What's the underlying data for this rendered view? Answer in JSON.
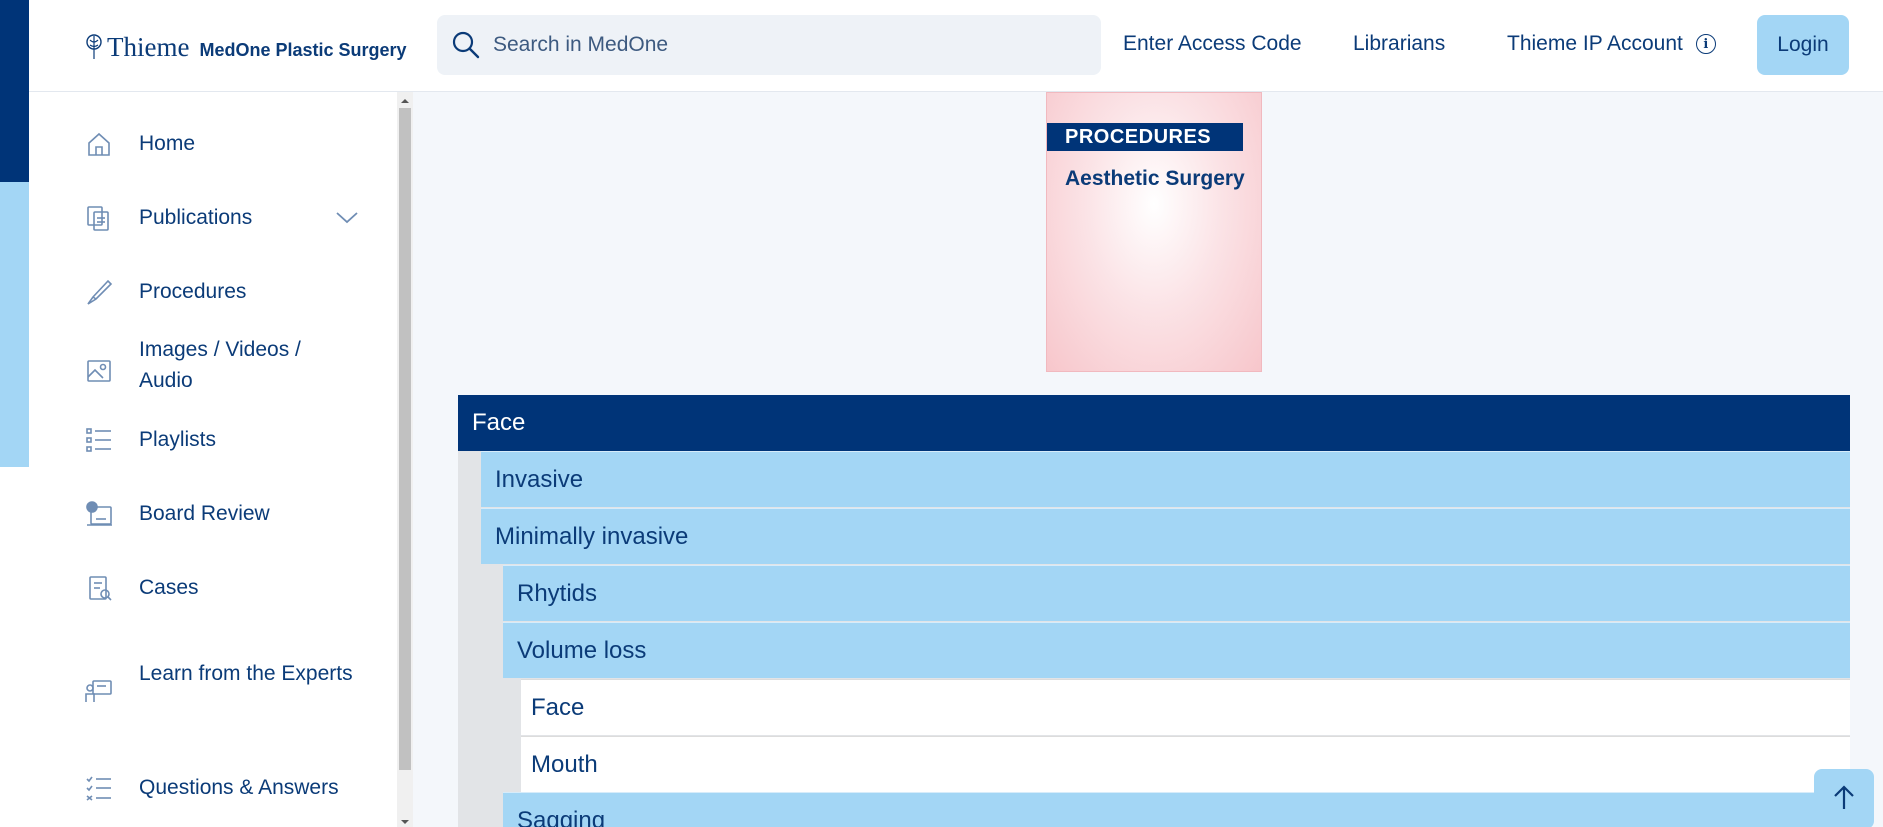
{
  "header": {
    "brand_name": "Thieme",
    "brand_product": "MedOne Plastic Surgery",
    "search_placeholder": "Search in MedOne",
    "links": {
      "access_code": "Enter Access Code",
      "librarians": "Librarians",
      "ip_account": "Thieme IP Account"
    },
    "login_label": "Login"
  },
  "sidebar": {
    "items": [
      {
        "label": "Home",
        "icon": "home-icon"
      },
      {
        "label": "Publications",
        "icon": "publications-icon",
        "expandable": true
      },
      {
        "label": "Procedures",
        "icon": "scalpel-icon"
      },
      {
        "label": "Images / Videos / Audio",
        "icon": "image-icon"
      },
      {
        "label": "Playlists",
        "icon": "playlist-icon"
      },
      {
        "label": "Board Review",
        "icon": "board-review-icon"
      },
      {
        "label": "Cases",
        "icon": "cases-icon"
      },
      {
        "label": "Learn from the Experts",
        "icon": "experts-icon"
      },
      {
        "label": "Questions & Answers",
        "icon": "questions-icon"
      }
    ]
  },
  "cover": {
    "band_text": "PROCEDURES",
    "subtitle": "Aesthetic Surgery"
  },
  "tree": [
    {
      "label": "Face",
      "level": 0
    },
    {
      "label": "Invasive",
      "level": 1
    },
    {
      "label": "Minimally invasive",
      "level": 1
    },
    {
      "label": "Rhytids",
      "level": 2
    },
    {
      "label": "Volume loss",
      "level": 2
    },
    {
      "label": "Face",
      "level": 3
    },
    {
      "label": "Mouth",
      "level": 3
    },
    {
      "label": "Sagging",
      "level": 2
    }
  ],
  "colors": {
    "navy": "#003478",
    "light_blue": "#a3d6f5",
    "text": "#0b3b78",
    "background": "#f4f7fb"
  }
}
